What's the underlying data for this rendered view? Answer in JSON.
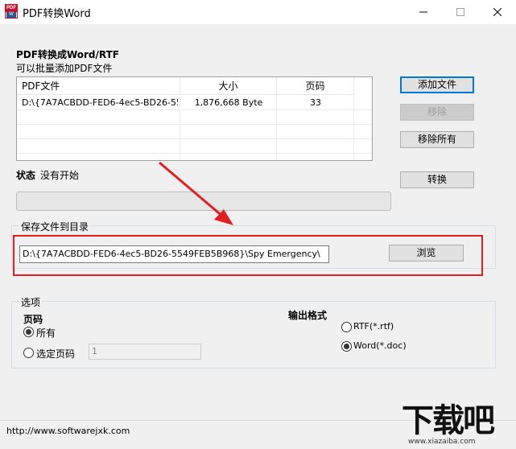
{
  "window": {
    "title": "PDF转换Word",
    "icon": "pdf-to-word-app-icon"
  },
  "convert_section": {
    "heading": "PDF转换成Word/RTF",
    "subheading": "可以批量添加PDF文件"
  },
  "file_list": {
    "columns": [
      "PDF文件",
      "大小",
      "页码"
    ],
    "rows": [
      {
        "file": "D:\\{7A7ACBDD-FED6-4ec5-BD26-554...",
        "size": "1,876,668 Byte",
        "pages": "33"
      }
    ]
  },
  "buttons": {
    "add_file": "添加文件",
    "remove": "移除",
    "remove_all": "移除所有",
    "convert": "转换",
    "browse": "浏览"
  },
  "status": {
    "label": "状态",
    "value": "没有开始",
    "progress": 0
  },
  "save_section": {
    "label": "保存文件到目录",
    "path": "D:\\{7A7ACBDD-FED6-4ec5-BD26-5549FEB5B968}\\Spy Emergency\\"
  },
  "options": {
    "label": "选项",
    "pages_label": "页码",
    "all_label": "所有",
    "selected_label": "选定页码",
    "selected_value": "1",
    "pages_mode": "all",
    "format_label": "输出格式",
    "rtf_label": "RTF(*.rtf)",
    "word_label": "Word(*.doc)",
    "format": "word"
  },
  "footer": {
    "url": "http://www.softwarejxk.com"
  },
  "watermark": {
    "brand": "下载吧",
    "site": "www.xiazaiba.com"
  },
  "colors": {
    "highlight": "#e21e22",
    "arrow": "#e21e22",
    "focus": "#0078d7"
  }
}
